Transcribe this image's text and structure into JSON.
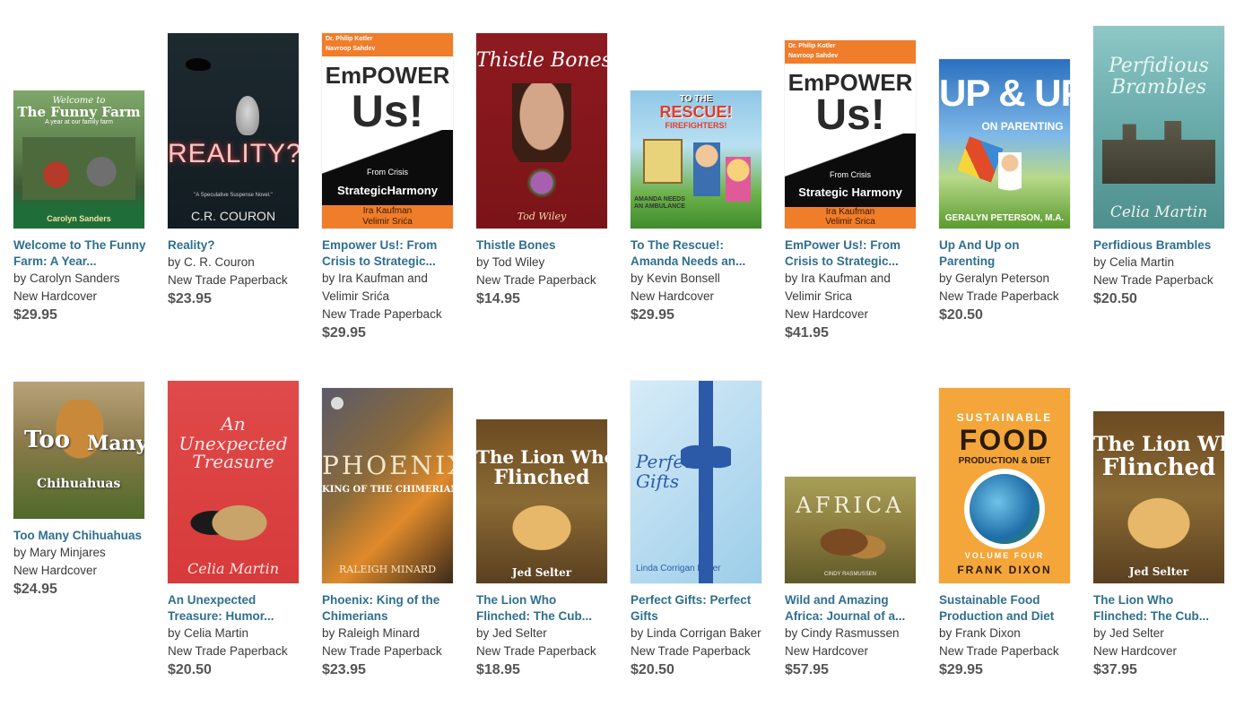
{
  "books": [
    {
      "title": "Welcome to The Funny Farm: A Year...",
      "author": "by Carolyn Sanders",
      "format": "New Hardcover",
      "price": "$29.95",
      "cover": {
        "line1": "Welcome to",
        "line2": "The Funny Farm",
        "line3": "A year at our family farm",
        "line4": "Carolyn Sanders"
      }
    },
    {
      "title": "Reality?",
      "author": "by C. R. Couron",
      "format": "New Trade Paperback",
      "price": "$23.95",
      "cover": {
        "line1": "REALITY?",
        "line2": "\"A Speculative Suspense Novel.\"",
        "line3": "C.R. COURON"
      }
    },
    {
      "title": "Empower Us!: From Crisis to Strategic...",
      "author": "by Ira Kaufman and Velimir Srića",
      "format": "New Trade Paperback",
      "price": "$29.95",
      "cover": {
        "line1": "Dr. Philip Kotler",
        "line2": "Navroop Sahdev",
        "line3": "EmPOWER",
        "line4": "Us!",
        "line5": "From Crisis",
        "line6": "StrategicHarmony",
        "line7": "Ira Kaufman",
        "line8": "Velimir Srića"
      }
    },
    {
      "title": "Thistle Bones",
      "author": "by Tod Wiley",
      "format": "New Trade Paperback",
      "price": "$14.95",
      "cover": {
        "line1": "Thistle Bones",
        "line2": "Tod Wiley"
      }
    },
    {
      "title": "To The Rescue!: Amanda Needs an...",
      "author": "by Kevin Bonsell",
      "format": "New Hardcover",
      "price": "$29.95",
      "cover": {
        "line1": "TO THE",
        "line2": "RESCUE!",
        "line3": "FIREFIGHTERS!",
        "line4": "AMANDA NEEDS AN AMBULANCE"
      }
    },
    {
      "title": "EmPower Us!: From Crisis to Strategic...",
      "author": "by Ira Kaufman and Velimir Srica",
      "format": "New Hardcover",
      "price": "$41.95",
      "cover": {
        "line1": "Dr. Philip Kotler",
        "line2": "Navroop Sahdev",
        "line3": "EmPOWER",
        "line4": "Us!",
        "line5": "From Crisis",
        "line6": "Strategic Harmony",
        "line7": "Ira Kaufman",
        "line8": "Velimir Srica"
      }
    },
    {
      "title": "Up And Up on Parenting",
      "author": "by Geralyn Peterson",
      "format": "New Trade Paperback",
      "price": "$20.50",
      "cover": {
        "line1": "UP & UP",
        "line2": "ON PARENTING",
        "line3": "GERALYN PETERSON, M.A."
      }
    },
    {
      "title": "Perfidious Brambles",
      "author": "by Celia Martin",
      "format": "New Trade Paperback",
      "price": "$20.50",
      "cover": {
        "line1": "Perfidious",
        "line2": "Brambles",
        "line3": "Celia Martin"
      }
    },
    {
      "title": "Too Many Chihuahuas",
      "author": "by Mary Minjares",
      "format": "New Hardcover",
      "price": "$24.95",
      "cover": {
        "line1": "Too",
        "line2": "Many",
        "line3": "Chihuahuas"
      }
    },
    {
      "title": "An Unexpected Treasure: Humor...",
      "author": "by Celia Martin",
      "format": "New Trade Paperback",
      "price": "$20.50",
      "cover": {
        "line1": "An",
        "line2": "Unexpected",
        "line3": "Treasure",
        "line4": "Celia Martin"
      }
    },
    {
      "title": "Phoenix: King of the Chimerians",
      "author": "by Raleigh Minard",
      "format": "New Trade Paperback",
      "price": "$23.95",
      "cover": {
        "line1": "PHOENIX",
        "line2": "KING OF THE CHIMERIANS",
        "line3": "RALEIGH MINARD"
      }
    },
    {
      "title": "The Lion Who Flinched: The Cub...",
      "author": "by Jed Selter",
      "format": "New Trade Paperback",
      "price": "$18.95",
      "cover": {
        "line1": "The Lion Who",
        "line2": "Flinched",
        "line3": "Jed Selter"
      }
    },
    {
      "title": "Perfect Gifts: Perfect Gifts",
      "author": "by Linda Corrigan Baker",
      "format": "New Trade Paperback",
      "price": "$20.50",
      "cover": {
        "line1": "Perfect",
        "line2": "Gifts",
        "line3": "Linda Corrigan Baker"
      }
    },
    {
      "title": "Wild and Amazing Africa: Journal of a...",
      "author": "by Cindy Rasmussen",
      "format": "New Hardcover",
      "price": "$57.95",
      "cover": {
        "line1": "AFRICA",
        "line2": "CINDY RASMUSSEN"
      }
    },
    {
      "title": "Sustainable Food Production and Diet",
      "author": "by Frank Dixon",
      "format": "New Trade Paperback",
      "price": "$29.95",
      "cover": {
        "line1": "SUSTAINABLE",
        "line2": "FOOD",
        "line3": "PRODUCTION & DIET",
        "line4": "VOLUME FOUR",
        "line5": "FRANK DIXON"
      }
    },
    {
      "title": "The Lion Who Flinched: The Cub...",
      "author": "by Jed Selter",
      "format": "New Hardcover",
      "price": "$37.95",
      "cover": {
        "line1": "The Lion Who",
        "line2": "Flinched",
        "line3": "Jed Selter"
      }
    }
  ]
}
